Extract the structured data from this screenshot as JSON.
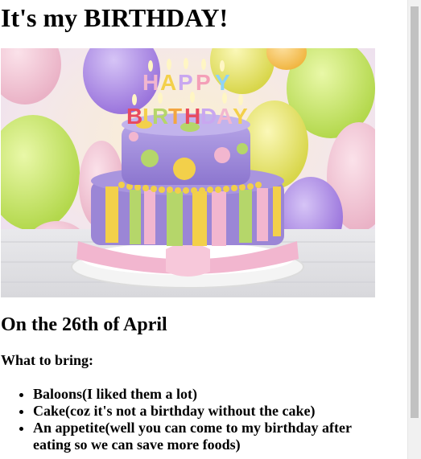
{
  "page": {
    "title": "It's my BIRTHDAY!",
    "date_heading": "On the 26th of April",
    "bring_heading": "What to bring:",
    "bring_items": [
      "Baloons(I liked them a lot)",
      "Cake(coz it's not a birthday without the cake)",
      "An appetite(well you can come to my birthday after eating so we can save more foods)"
    ]
  },
  "image": {
    "icon": "birthday-cake-photo",
    "candle_letters": [
      "H",
      "A",
      "P",
      "P",
      "Y",
      "B",
      "I",
      "R",
      "T",
      "H",
      "D",
      "A",
      "Y"
    ]
  },
  "colors": {
    "cake_purple": "#9b86d6",
    "cake_pink": "#f2b6cf",
    "cake_green": "#b5d66a",
    "cake_yellow": "#f3d04a",
    "balloon_purple": "#a98be0",
    "balloon_yellow": "#eee46a",
    "scrollbar_thumb": "#c1c1c1",
    "scrollbar_track": "#f1f1f1"
  }
}
